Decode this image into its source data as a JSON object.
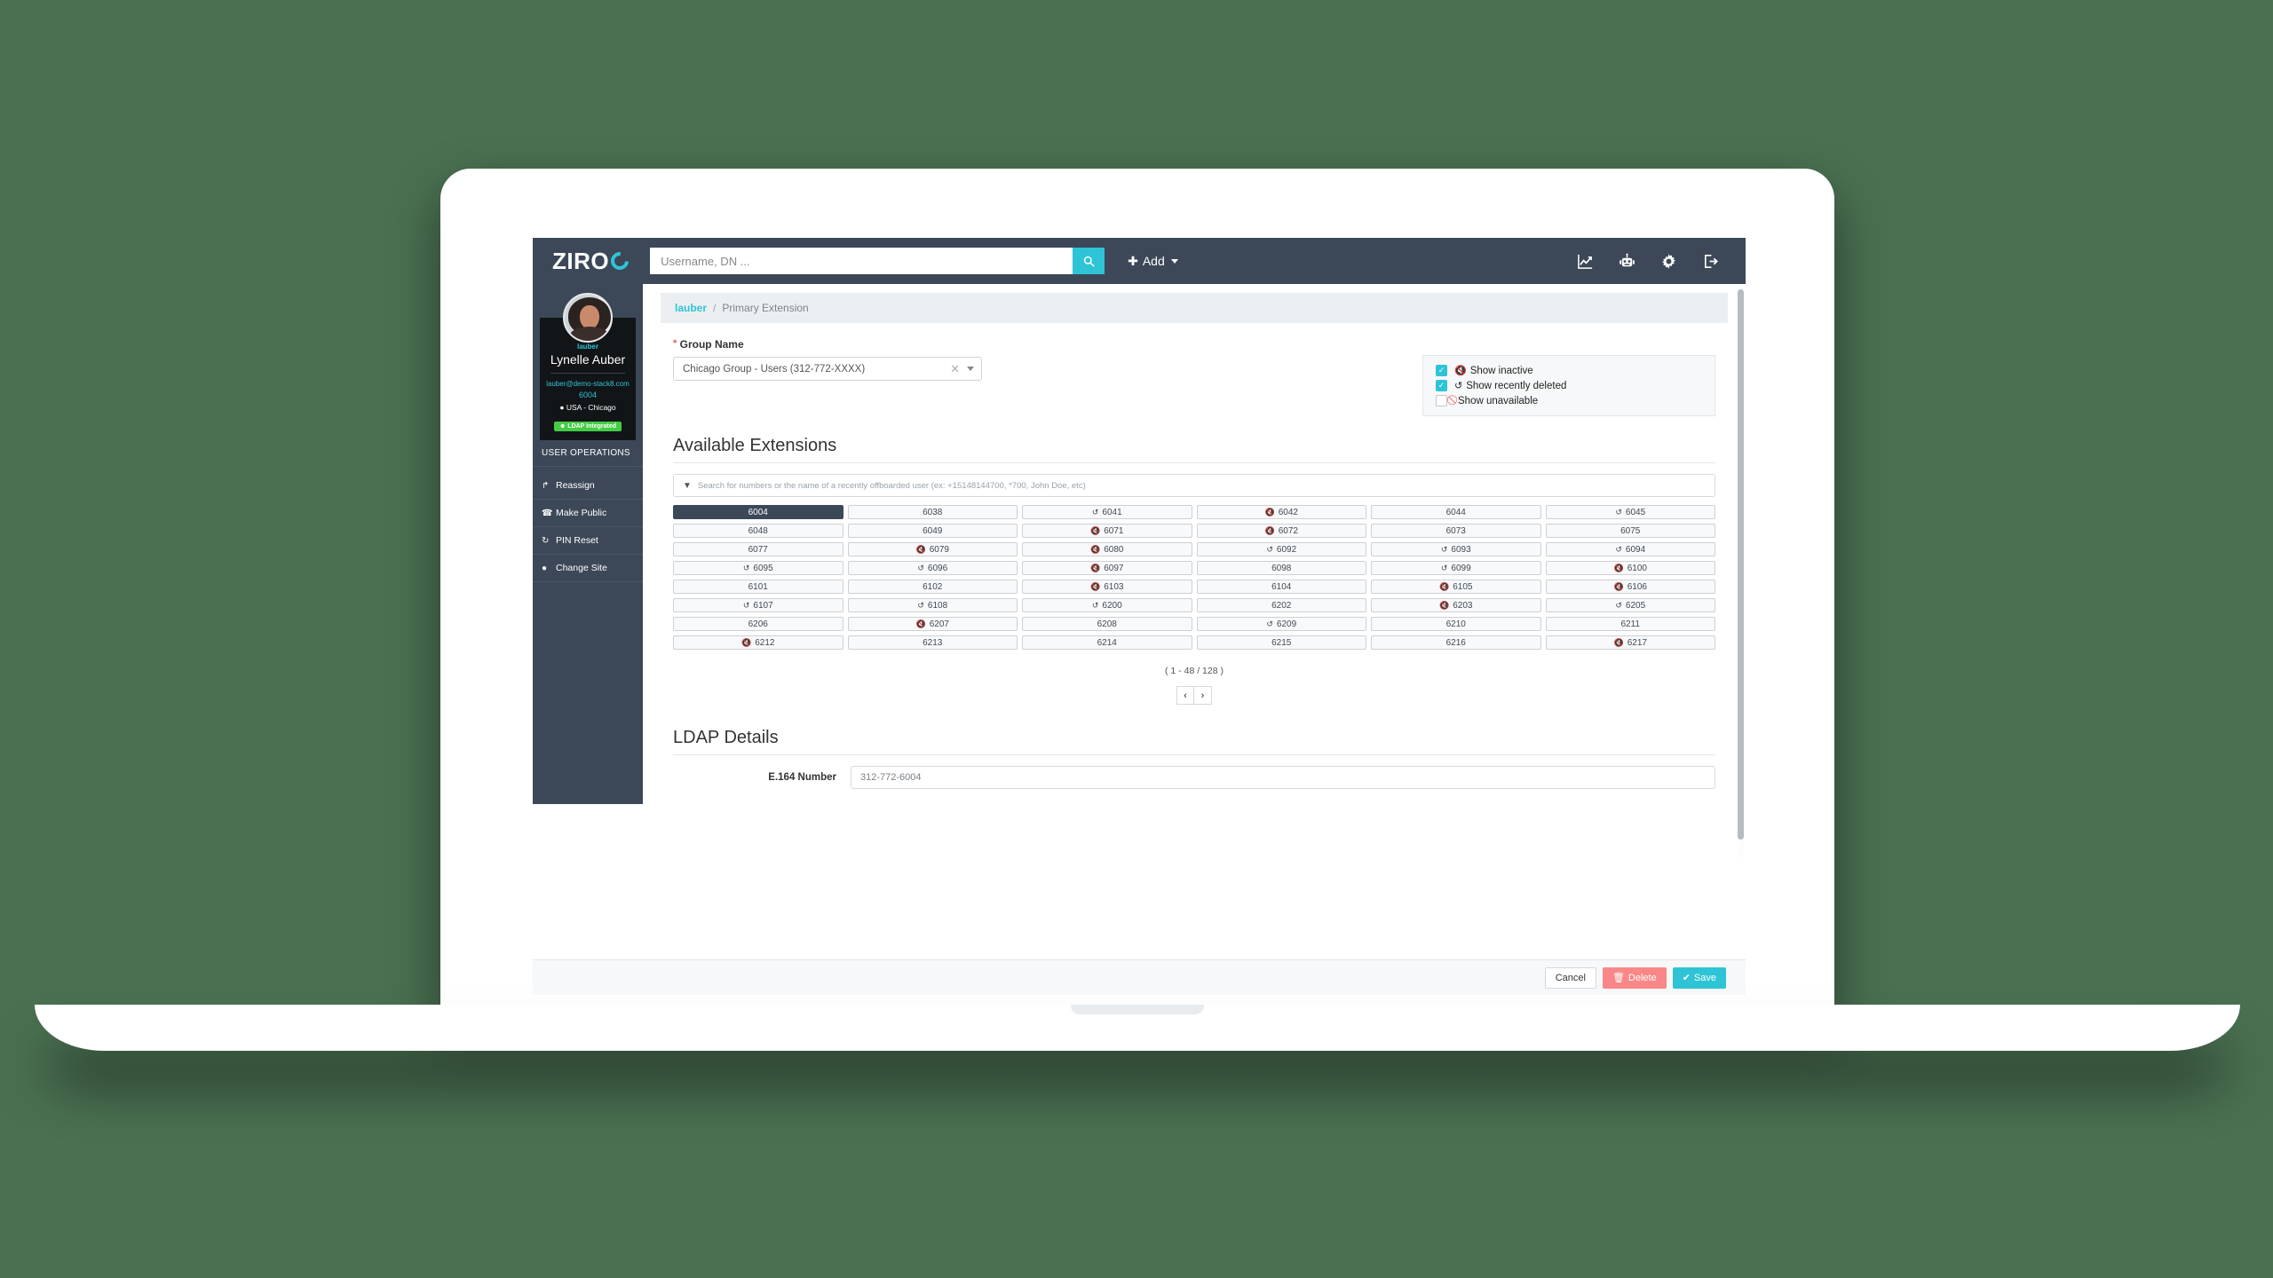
{
  "app": {
    "brand_name": "ZIRO"
  },
  "navbar": {
    "search_placeholder": "Username, DN ...",
    "search_value": "",
    "search_button_icon": "search-icon",
    "add_label": "Add",
    "icons": [
      {
        "name": "analytics-icon",
        "label": "Analytics"
      },
      {
        "name": "robot-icon",
        "label": "Automation"
      },
      {
        "name": "gear-icon",
        "label": "Settings"
      },
      {
        "name": "sign-out-icon",
        "label": "Sign out"
      }
    ]
  },
  "sidebar": {
    "profile": {
      "username": "lauber",
      "full_name": "Lynelle Auber",
      "email": "lauber@demo-stack8.com",
      "extension": "6004",
      "location": "USA - Chicago",
      "location_icon": "map-marker-icon",
      "badge": "LDAP Integrated",
      "badge_icon": "user-icon",
      "badge_color": "#44cc44"
    },
    "operations_header": "USER OPERATIONS",
    "operations": [
      {
        "label": "Reassign",
        "icon": "walking-icon",
        "glyph": "↱"
      },
      {
        "label": "Make Public",
        "icon": "phone-icon",
        "glyph": "☎"
      },
      {
        "label": "PIN Reset",
        "icon": "refresh-icon",
        "glyph": "↻"
      },
      {
        "label": "Change Site",
        "icon": "map-marker-icon",
        "glyph": "✈"
      }
    ]
  },
  "breadcrumb": {
    "root": "lauber",
    "separator": "/",
    "current": "Primary Extension"
  },
  "form": {
    "group_name_label": "Group Name",
    "group_name_required": true,
    "group_name_value": "Chicago Group - Users (312-772-XXXX)",
    "clear_icon": "close-icon",
    "caret_icon": "chevron-down-icon"
  },
  "filters": [
    {
      "label": "Show inactive",
      "checked": true,
      "icon": "inactive-icon",
      "glyph": "🔇"
    },
    {
      "label": "Show recently deleted",
      "checked": true,
      "icon": "history-icon",
      "glyph": "↺"
    },
    {
      "label": "Show unavailable",
      "checked": false,
      "icon": "ban-icon",
      "glyph": "⃠"
    }
  ],
  "available_extensions": {
    "title": "Available Extensions",
    "search_placeholder": "Search for numbers or the name of a recently offboarded user (ex: +15148144700, *700, John Doe, etc)",
    "search_value": "",
    "filter_icon": "funnel-icon",
    "cells": [
      {
        "number": "6004",
        "state": "selected",
        "glyph": ""
      },
      {
        "number": "6038",
        "state": "available",
        "glyph": ""
      },
      {
        "number": "6041",
        "state": "deleted",
        "glyph": "↺"
      },
      {
        "number": "6042",
        "state": "inactive",
        "glyph": "🔇"
      },
      {
        "number": "6044",
        "state": "available",
        "glyph": ""
      },
      {
        "number": "6045",
        "state": "deleted",
        "glyph": "↺"
      },
      {
        "number": "6048",
        "state": "available",
        "glyph": ""
      },
      {
        "number": "6049",
        "state": "available",
        "glyph": ""
      },
      {
        "number": "6071",
        "state": "inactive",
        "glyph": "🔇"
      },
      {
        "number": "6072",
        "state": "inactive",
        "glyph": "🔇"
      },
      {
        "number": "6073",
        "state": "available",
        "glyph": ""
      },
      {
        "number": "6075",
        "state": "available",
        "glyph": ""
      },
      {
        "number": "6077",
        "state": "available",
        "glyph": ""
      },
      {
        "number": "6079",
        "state": "inactive",
        "glyph": "🔇"
      },
      {
        "number": "6080",
        "state": "inactive",
        "glyph": "🔇"
      },
      {
        "number": "6092",
        "state": "deleted",
        "glyph": "↺"
      },
      {
        "number": "6093",
        "state": "deleted",
        "glyph": "↺"
      },
      {
        "number": "6094",
        "state": "deleted",
        "glyph": "↺"
      },
      {
        "number": "6095",
        "state": "deleted",
        "glyph": "↺"
      },
      {
        "number": "6096",
        "state": "deleted",
        "glyph": "↺"
      },
      {
        "number": "6097",
        "state": "inactive",
        "glyph": "🔇"
      },
      {
        "number": "6098",
        "state": "available",
        "glyph": ""
      },
      {
        "number": "6099",
        "state": "deleted",
        "glyph": "↺"
      },
      {
        "number": "6100",
        "state": "inactive",
        "glyph": "🔇"
      },
      {
        "number": "6101",
        "state": "available",
        "glyph": ""
      },
      {
        "number": "6102",
        "state": "available",
        "glyph": ""
      },
      {
        "number": "6103",
        "state": "inactive",
        "glyph": "🔇"
      },
      {
        "number": "6104",
        "state": "available",
        "glyph": ""
      },
      {
        "number": "6105",
        "state": "inactive",
        "glyph": "🔇"
      },
      {
        "number": "6106",
        "state": "inactive",
        "glyph": "🔇"
      },
      {
        "number": "6107",
        "state": "deleted",
        "glyph": "↺"
      },
      {
        "number": "6108",
        "state": "deleted",
        "glyph": "↺"
      },
      {
        "number": "6200",
        "state": "deleted",
        "glyph": "↺"
      },
      {
        "number": "6202",
        "state": "available",
        "glyph": ""
      },
      {
        "number": "6203",
        "state": "inactive",
        "glyph": "🔇"
      },
      {
        "number": "6205",
        "state": "deleted",
        "glyph": "↺"
      },
      {
        "number": "6206",
        "state": "available",
        "glyph": ""
      },
      {
        "number": "6207",
        "state": "inactive",
        "glyph": "🔇"
      },
      {
        "number": "6208",
        "state": "available",
        "glyph": ""
      },
      {
        "number": "6209",
        "state": "deleted",
        "glyph": "↺"
      },
      {
        "number": "6210",
        "state": "available",
        "glyph": ""
      },
      {
        "number": "6211",
        "state": "available",
        "glyph": ""
      },
      {
        "number": "6212",
        "state": "inactive",
        "glyph": "🔇"
      },
      {
        "number": "6213",
        "state": "available",
        "glyph": ""
      },
      {
        "number": "6214",
        "state": "available",
        "glyph": ""
      },
      {
        "number": "6215",
        "state": "available",
        "glyph": ""
      },
      {
        "number": "6216",
        "state": "available",
        "glyph": ""
      },
      {
        "number": "6217",
        "state": "inactive",
        "glyph": "🔇"
      }
    ],
    "pagination": {
      "count_text": "( 1 - 48 / 128 )",
      "range_start": 1,
      "range_end": 48,
      "total": 128,
      "prev_label": "‹",
      "next_label": "›"
    }
  },
  "ldap": {
    "title": "LDAP Details",
    "e164_label": "E.164 Number",
    "e164_value": "312-772-6004"
  },
  "actions": {
    "cancel_label": "Cancel",
    "delete_label": "Delete",
    "delete_icon": "trash-icon",
    "save_label": "Save",
    "save_icon": "check-icon"
  },
  "theme": {
    "accent": "#2ec4d6",
    "dark": "#3c4858",
    "danger": "#f98787",
    "success": "#44cc44",
    "page_background": "#4a7051"
  }
}
